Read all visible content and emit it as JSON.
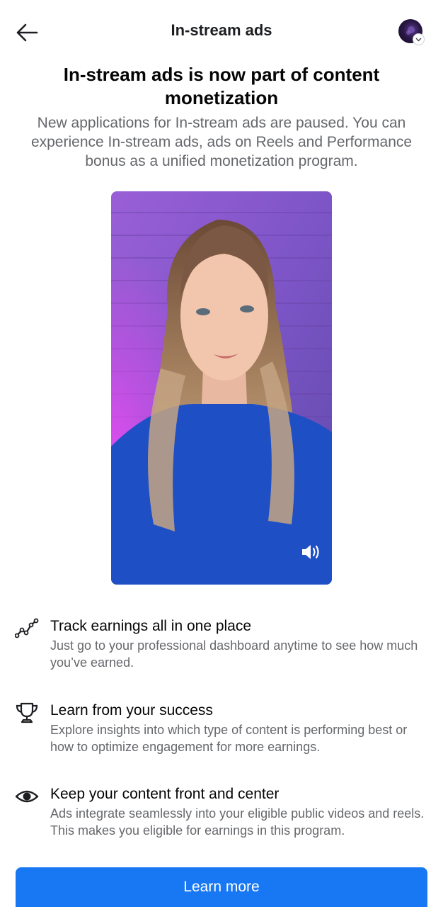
{
  "header": {
    "title": "In-stream ads",
    "back_icon": "arrow-left-icon",
    "avatar_icon": "profile-avatar"
  },
  "headline": "In-stream ads is now part of content monetization",
  "subtext": "New applications for In-stream ads are paused. You can experience In-stream ads, ads on Reels and Performance bonus as a unified monetization program.",
  "video": {
    "volume_icon": "speaker-icon"
  },
  "features": [
    {
      "icon": "trend-line-icon",
      "title": "Track earnings all in one place",
      "desc": "Just go to your professional dashboard anytime to see how much you’ve earned."
    },
    {
      "icon": "trophy-icon",
      "title": "Learn from your success",
      "desc": "Explore insights into which type of content is performing best or how to optimize engagement for more earnings."
    },
    {
      "icon": "eye-icon",
      "title": "Keep your content front and center",
      "desc": "Ads integrate seamlessly into your eligible public videos and reels. This makes you eligible for earnings in this program."
    }
  ],
  "cta": {
    "label": "Learn more"
  },
  "colors": {
    "primary": "#1877f2",
    "text": "#050505",
    "secondary_text": "#65676b"
  }
}
